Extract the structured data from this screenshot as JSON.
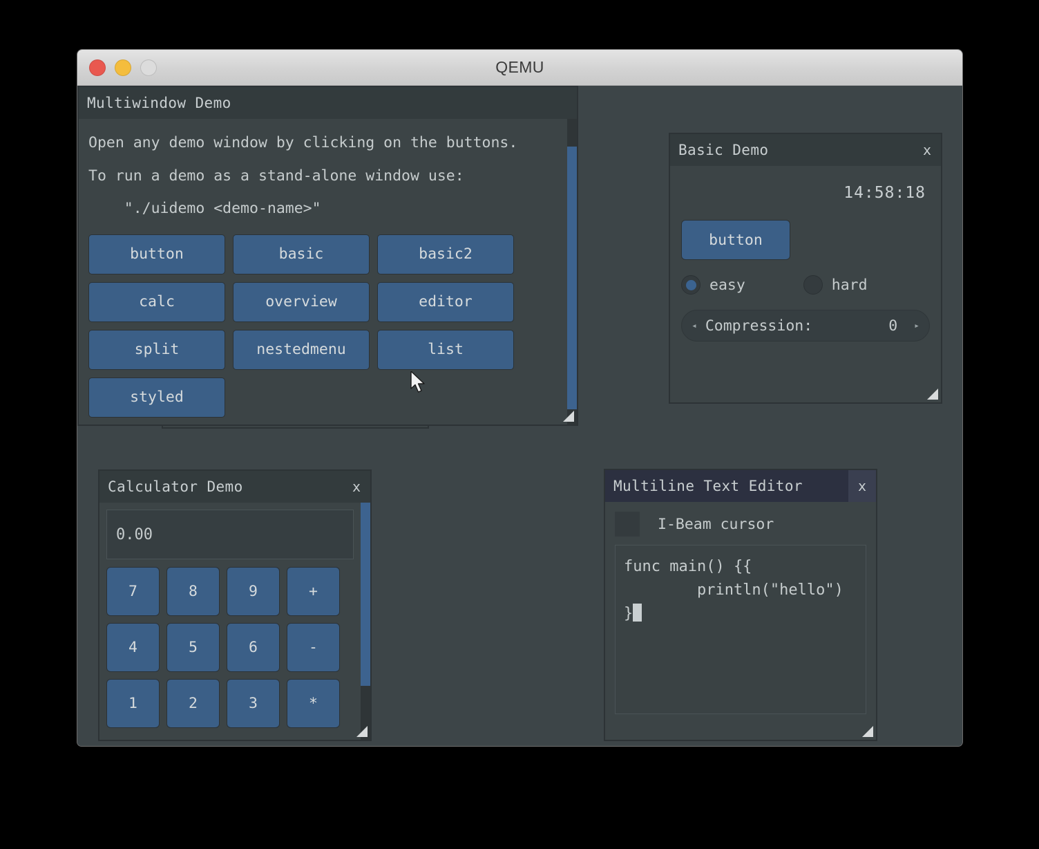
{
  "host_window": {
    "title": "QEMU",
    "traffic_lights": [
      "close",
      "minimize",
      "zoom"
    ]
  },
  "windows": {
    "multiwindow": {
      "title": "Multiwindow Demo",
      "lines": [
        "Open any demo window by clicking on the buttons.",
        "To run a demo as a stand-alone window use:",
        "    \"./uidemo <demo-name>\""
      ],
      "buttons": [
        "button",
        "basic",
        "basic2",
        "calc",
        "overview",
        "editor",
        "split",
        "nestedmenu",
        "list",
        "styled"
      ]
    },
    "basic": {
      "title": "Basic Demo",
      "close_label": "x",
      "clock": "14:58:18",
      "button_label": "button",
      "radios": [
        {
          "label": "easy",
          "selected": true
        },
        {
          "label": "hard",
          "selected": false
        }
      ],
      "slider": {
        "label": "Compression:",
        "value": "0",
        "left_arrow": "◂",
        "right_arrow": "▸"
      }
    },
    "calculator": {
      "title": "Calculator Demo",
      "close_label": "x",
      "display": "0.00",
      "keys": [
        "7",
        "8",
        "9",
        "+",
        "4",
        "5",
        "6",
        "-",
        "1",
        "2",
        "3",
        "*"
      ]
    },
    "editor": {
      "title": "Multiline Text Editor",
      "close_label": "x",
      "cursor_label": "I-Beam cursor",
      "text_lines": [
        "func main() {{",
        "        println(\"hello\")",
        "}"
      ]
    }
  },
  "colors": {
    "desktop": "#000000",
    "qemu_canvas": "#3d4548",
    "window_bg": "#3c4446",
    "window_header": "#333b3d",
    "window_header_active": "#2c3040",
    "accent_blue": "#3b5f87",
    "scrollbar_thumb": "#3d638f",
    "text": "#c6cccd"
  }
}
